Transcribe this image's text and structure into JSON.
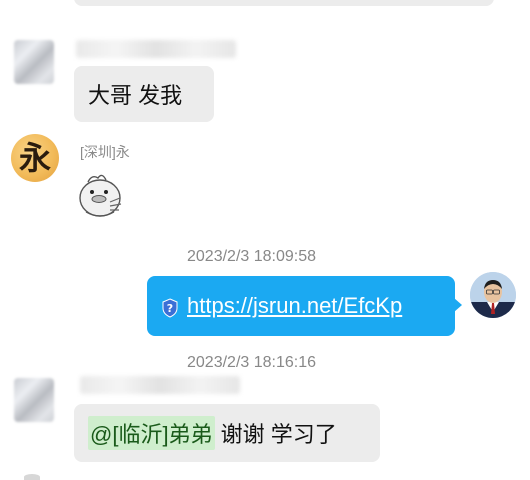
{
  "messages": {
    "msg1": {
      "text": "大哥 发我"
    },
    "msg2": {
      "sender": "[深圳]永",
      "avatar_char": "永",
      "sticker": "duck-sticker"
    },
    "ts1": "2023/2/3 18:09:58",
    "msg3": {
      "link": "https://jsrun.net/EfcKp",
      "icon": "shield-question-icon"
    },
    "ts2": "2023/2/3 18:16:16",
    "msg4": {
      "mention": "@[临沂]弟弟",
      "text": " 谢谢 学习了"
    }
  },
  "colors": {
    "incoming_bubble": "#ececec",
    "outgoing_bubble": "#1ba9f2",
    "mention_highlight": "#cfeecd",
    "timestamp": "#888888"
  }
}
